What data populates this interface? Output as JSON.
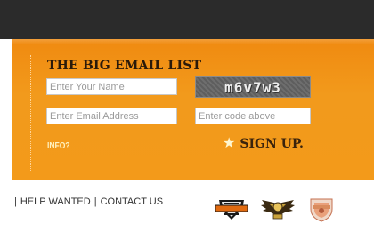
{
  "signup": {
    "title": "THE BIG EMAIL LIST",
    "name_placeholder": "Enter Your Name",
    "email_placeholder": "Enter Email Address",
    "code_placeholder": "Enter code above",
    "captcha_text": "m6v7w3",
    "info_label": "INFO?",
    "signup_label": "SIGN UP.",
    "signup_icon": "star-icon"
  },
  "footer": {
    "links": [
      "HELP WANTED",
      "CONTACT US"
    ],
    "separator": "|",
    "logos": [
      "harley-davidson-logo",
      "eagle-wings-logo",
      "shield-badge-logo"
    ]
  },
  "colors": {
    "top_bar": "#2b2b2b",
    "panel_orange": "#f39a1a",
    "title_text": "#2a1a0a",
    "info_text": "#fff2c0"
  }
}
